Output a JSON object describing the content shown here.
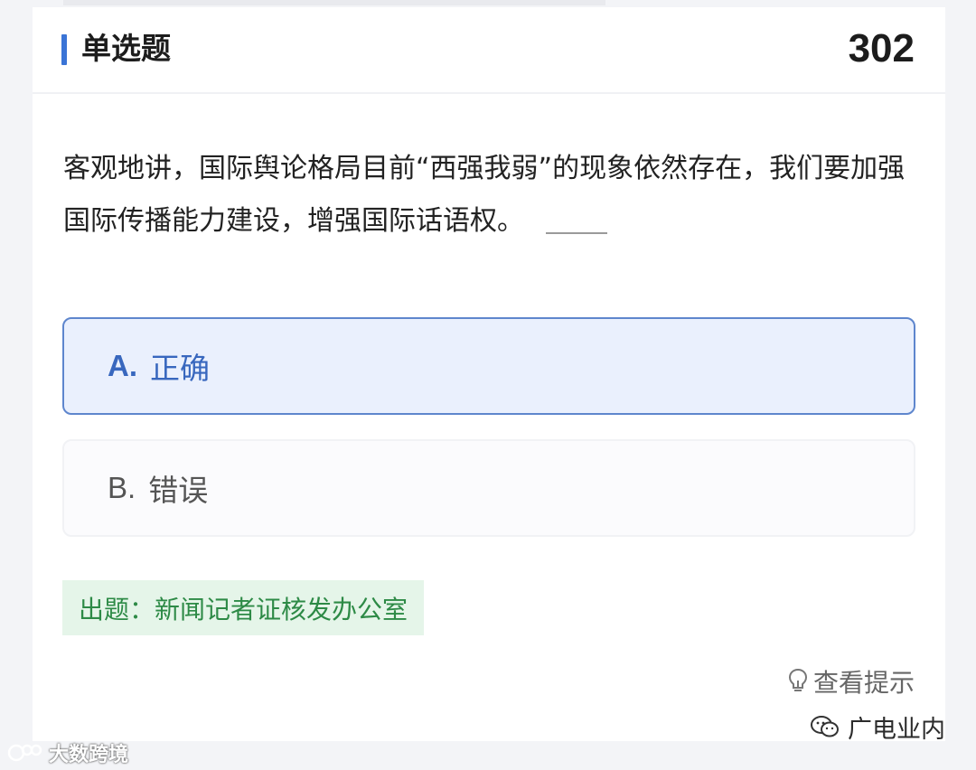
{
  "header": {
    "question_type": "单选题",
    "question_number": "302"
  },
  "question": {
    "text": "客观地讲，国际舆论格局目前“西强我弱”的现象依然存在，我们要加强国际传播能力建设，增强国际话语权。"
  },
  "options": [
    {
      "letter": "A.",
      "text": "正确",
      "selected": true
    },
    {
      "letter": "B.",
      "text": "错误",
      "selected": false
    }
  ],
  "source": {
    "text": "出题：新闻记者证核发办公室"
  },
  "hint": {
    "label": "查看提示",
    "icon": "lightbulb-icon"
  },
  "watermarks": {
    "right": "广电业内",
    "left": "大数跨境"
  },
  "colors": {
    "accent": "#3a74d6",
    "selected_bg": "#eaf0fd",
    "selected_border": "#5e86cd",
    "source_bg": "#e5f5e9",
    "source_text": "#2d8a46"
  }
}
